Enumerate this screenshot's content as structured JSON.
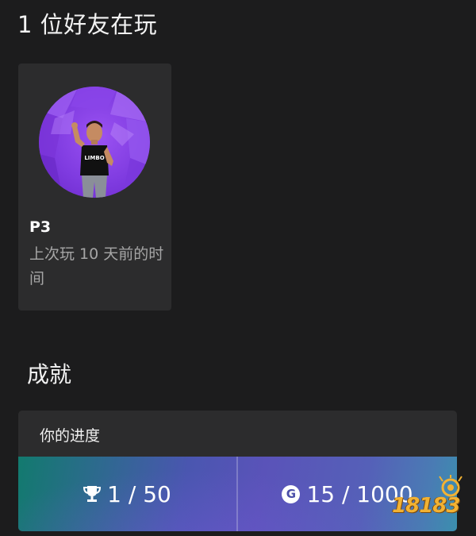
{
  "friends_playing": {
    "heading": "1 位好友在玩",
    "friend": {
      "gamertag": "P3",
      "last_played": "上次玩 10 天前的时间",
      "avatar_shirt_text": "LIMBO"
    }
  },
  "achievements": {
    "heading": "成就",
    "progress": {
      "title": "你的进度",
      "trophies_text": "1 / 50",
      "gamerscore_text": "15 / 1000",
      "gamerscore_badge": "G"
    }
  },
  "icons": {
    "trophy": "trophy-icon",
    "gamerscore": "gamerscore-icon"
  },
  "watermark": {
    "text": "18183"
  },
  "colors": {
    "background": "#1c1c1d",
    "card": "#2c2c2d",
    "secondary_text": "#a6a6a6",
    "avatar_purple": "#8a44ea",
    "band_teal": "#127a6e",
    "band_indigo": "#5a53b9"
  }
}
